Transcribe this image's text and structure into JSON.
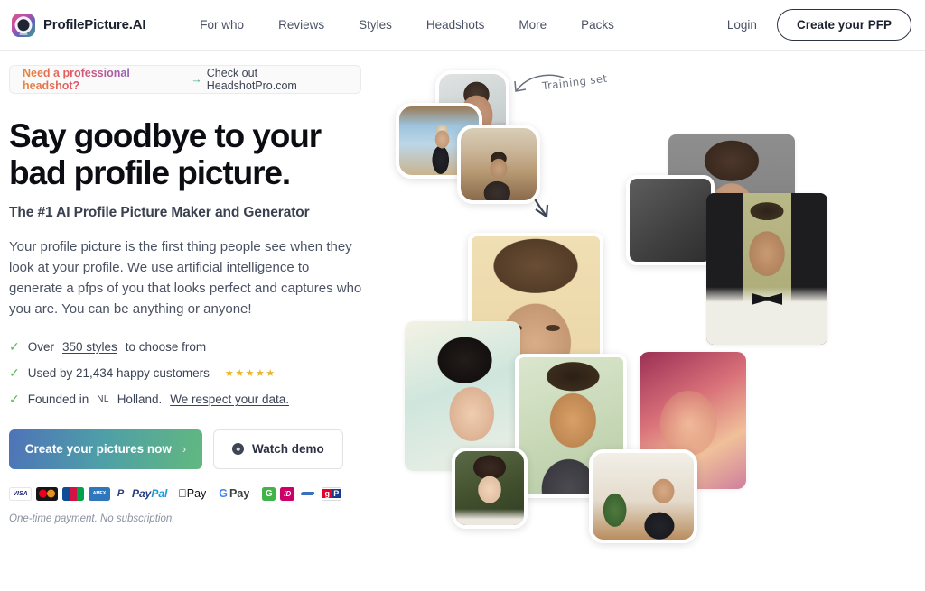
{
  "nav": {
    "brand": "ProfilePicture.AI",
    "logo_icon": "profile-avatar-logo-icon",
    "links": [
      {
        "label": "For who"
      },
      {
        "label": "Reviews"
      },
      {
        "label": "Styles"
      },
      {
        "label": "Headshots"
      },
      {
        "label": "More"
      },
      {
        "label": "Packs"
      }
    ],
    "login_label": "Login",
    "cta_label": "Create your PFP"
  },
  "promo": {
    "strong": "Need a professional headshot?",
    "arrow": "→",
    "rest": "Check out HeadshotPro.com"
  },
  "hero": {
    "headline_line1": "Say goodbye to your",
    "headline_line2": "bad profile picture.",
    "subhead": "The #1 AI Profile Picture Maker and Generator",
    "body": "Your profile picture is the first thing people see when they look at your profile. We use artificial intelligence to generate a pfps of you that looks perfect and captures who you are. You can be anything or anyone!"
  },
  "features": [
    {
      "check_icon": "check-icon",
      "prefix": "Over ",
      "link": "350 styles",
      "suffix": " to choose from",
      "stars": "",
      "smallcaps": ""
    },
    {
      "check_icon": "check-icon",
      "prefix": "Used by 21,434 happy customers",
      "link": "",
      "suffix": "",
      "stars": "★★★★★",
      "smallcaps": ""
    },
    {
      "check_icon": "check-icon",
      "prefix": "Founded in ",
      "smallcaps": "NL",
      "middle": " Holland. ",
      "link": "We respect your data.",
      "suffix": "",
      "stars": ""
    }
  ],
  "cta": {
    "primary_label": "Create your pictures now",
    "primary_chevron": "›",
    "secondary_label": "Watch demo",
    "secondary_icon": "play-circle-icon"
  },
  "payments": [
    {
      "name": "visa-icon",
      "label": "VISA"
    },
    {
      "name": "mastercard-icon",
      "label": ""
    },
    {
      "name": "jcb-icon",
      "label": ""
    },
    {
      "name": "amex-icon",
      "label": "AMEX"
    },
    {
      "name": "paypal-icon",
      "label": "PayPal"
    },
    {
      "name": "apple-pay-icon",
      "label": "Pay"
    },
    {
      "name": "google-pay-icon",
      "label": "Pay"
    },
    {
      "name": "giropay-icon",
      "label": "G"
    },
    {
      "name": "ideal-icon",
      "label": "iD"
    },
    {
      "name": "sofort-icon",
      "label": ""
    },
    {
      "name": "gp-icon",
      "label": "gP"
    }
  ],
  "payment_note": "One-time payment. No subscription.",
  "collage": {
    "annotation": "Training set",
    "annotation_arrow_icon": "curved-arrow-left-icon",
    "flow_arrow_icon": "arrow-down-right-icon",
    "training_photos": [
      {
        "name": "training-photo-mirror-selfie"
      },
      {
        "name": "training-photo-beach"
      },
      {
        "name": "training-photo-store"
      }
    ],
    "generated_photos": [
      {
        "name": "generated-photo-grey-portrait"
      },
      {
        "name": "generated-photo-floral-crown"
      },
      {
        "name": "generated-photo-bowtie"
      },
      {
        "name": "generated-photo-closeup-eyes"
      },
      {
        "name": "generated-photo-pastel-headband"
      },
      {
        "name": "generated-photo-golden-light"
      },
      {
        "name": "generated-photo-pink-closeup"
      },
      {
        "name": "generated-photo-anime"
      },
      {
        "name": "generated-photo-cafe-smile"
      }
    ]
  }
}
